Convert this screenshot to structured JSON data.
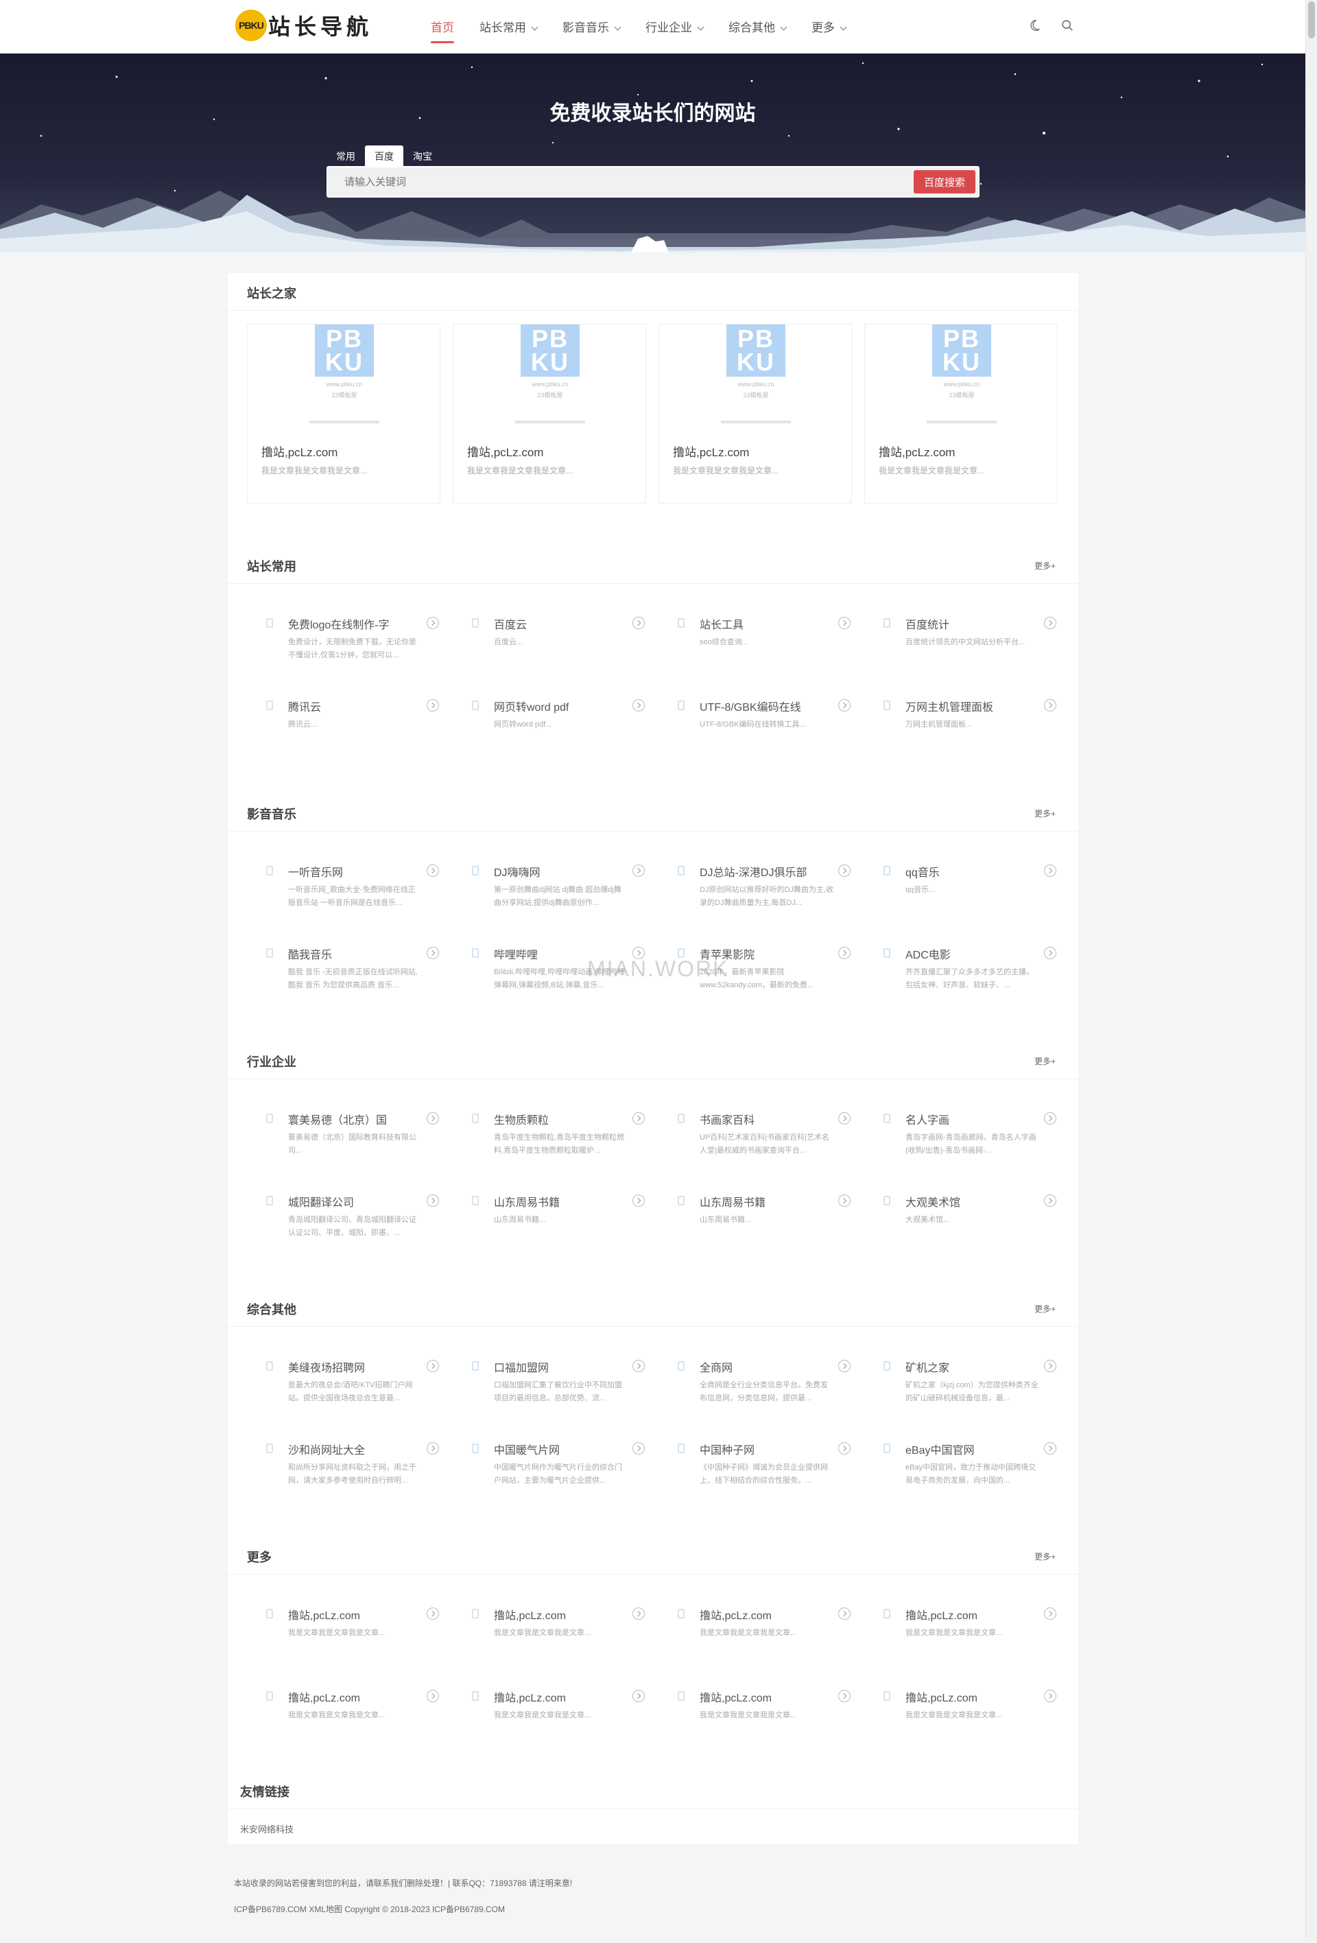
{
  "header": {
    "logo_badge": "PBKU",
    "logo_text": "站长导航",
    "nav": [
      {
        "label": "首页",
        "active": true,
        "has_menu": false
      },
      {
        "label": "站长常用",
        "active": false,
        "has_menu": true
      },
      {
        "label": "影音音乐",
        "active": false,
        "has_menu": true
      },
      {
        "label": "行业企业",
        "active": false,
        "has_menu": true
      },
      {
        "label": "综合其他",
        "active": false,
        "has_menu": true
      },
      {
        "label": "更多",
        "active": false,
        "has_menu": true
      }
    ],
    "icons": [
      "moon-icon",
      "search-icon"
    ]
  },
  "hero": {
    "title": "免费收录站长们的网站",
    "tabs": [
      "常用",
      "百度",
      "淘宝"
    ],
    "active_tab": 1,
    "search_placeholder": "请输入关键词",
    "search_button": "百度搜索"
  },
  "sections": [
    {
      "title": "站长之家",
      "more": "",
      "cards": [
        {
          "logo": "PBKU",
          "sub1": "www.pbku.cn",
          "sub2": "23模板屋",
          "title": "撸站,pcLz.com",
          "desc": "我是文章我是文章我是文章..."
        },
        {
          "logo": "PBKU",
          "sub1": "www.pbku.cn",
          "sub2": "23模板屋",
          "title": "撸站,pcLz.com",
          "desc": "我是文章我是文章我是文章..."
        },
        {
          "logo": "PBKU",
          "sub1": "www.pbku.cn",
          "sub2": "23模板屋",
          "title": "撸站,pcLz.com",
          "desc": "我是文章我是文章我是文章..."
        },
        {
          "logo": "PBKU",
          "sub1": "www.pbku.cn",
          "sub2": "23模板屋",
          "title": "撸站,pcLz.com",
          "desc": "我是文章我是文章我是文章..."
        }
      ]
    },
    {
      "title": "站长常用",
      "more": "更多+",
      "items": [
        {
          "title": "免费logo在线制作-字",
          "desc": "免费设计，无限制免费下载，无论你是不懂设计,仅需1分钟，您就可以..."
        },
        {
          "title": "百度云",
          "desc": "百度云..."
        },
        {
          "title": "站长工具",
          "desc": "seo综合查询..."
        },
        {
          "title": "百度统计",
          "desc": "百度统计领先的中文网站分析平台..."
        },
        {
          "title": "腾讯云",
          "desc": "腾讯云..."
        },
        {
          "title": "网页转word pdf",
          "desc": "网页转word pdf..."
        },
        {
          "title": "UTF-8/GBK编码在线",
          "desc": "UTF-8/GBK编码在线转换工具..."
        },
        {
          "title": "万网主机管理面板",
          "desc": "万网主机管理面板..."
        }
      ]
    },
    {
      "title": "影音音乐",
      "more": "更多+",
      "items": [
        {
          "title": "一听音乐网",
          "desc": "一听音乐网_歌曲大全-免费网络在线正版音乐站 一听音乐网是在线音乐..."
        },
        {
          "title": "DJ嗨嗨网",
          "desc": "第一原创舞曲dj网站 dj舞曲 超劲爆dj舞曲分享网站,提供dj舞曲原创作..."
        },
        {
          "title": "DJ总站-深港DJ俱乐部",
          "desc": "DJ原创网站以推荐好听的DJ舞曲为主,收录的DJ舞曲质量为主,每首DJ..."
        },
        {
          "title": "qq音乐",
          "desc": "qq音乐..."
        },
        {
          "title": "酷我音乐",
          "desc": "酷我 音乐 -无损音质正版在线试听网站,酷我 音乐 为您提供高品质 音乐..."
        },
        {
          "title": "哔哩哔哩",
          "desc": "Bilibili,哔哩哔哩,哔哩哔哩动画,哔哩哔哩弹幕网,弹幕视频,B站,弹幕,音乐..."
        },
        {
          "title": "青苹果影院",
          "desc": "2020年，最新青苹果影院 www.52kandy.com，最新的免费..."
        },
        {
          "title": "ADC电影",
          "desc": "齐齐直播汇聚了众多多才多艺的主播，包括女神、好声音、软妹子、..."
        }
      ]
    },
    {
      "title": "行业企业",
      "more": "更多+",
      "items": [
        {
          "title": "寰美易德（北京）国",
          "desc": "寰美易德（北京）国际教育科技有限公司..."
        },
        {
          "title": "生物质颗粒",
          "desc": "青岛平度生物颗粒,青岛平度生物颗粒燃料,青岛平度生物质颗粒取暖炉..."
        },
        {
          "title": "书画家百科",
          "desc": "UP百科|艺术家百科|书画家百科|艺术名人堂|最权威的书画家查询平台..."
        },
        {
          "title": "名人字画",
          "desc": "青岛字画网-青岛画廊网、青岛名人字画(收购/出售)-青岛书画网-..."
        },
        {
          "title": "城阳翻译公司",
          "desc": "青岛城阳翻译公司、青岛城阳翻译公证认证公司、平度、城阳、即墨、..."
        },
        {
          "title": "山东周易书籍",
          "desc": "山东周易书籍..."
        },
        {
          "title": "山东周易书籍",
          "desc": "山东周易书籍..."
        },
        {
          "title": "大观美术馆",
          "desc": "大观美术馆..."
        }
      ]
    },
    {
      "title": "综合其他",
      "more": "更多+",
      "items": [
        {
          "title": "美缝夜场招聘网",
          "desc": "是最大的夜总会/酒吧/KTV招聘门户网站。提供全国夜场夜总会生意最..."
        },
        {
          "title": "口福加盟网",
          "desc": "口福加盟网汇集了餐饮行业中不同加盟项目的最用信息。总部优势、流..."
        },
        {
          "title": "全商网",
          "desc": "全商网是全行业分类信息平台。免费发布信息网，分类信息网，提供最..."
        },
        {
          "title": "矿机之家",
          "desc": "矿机之家（kjzj.com）为您提供种类齐全的矿山破碎机械设备信息，最..."
        },
        {
          "title": "沙和尚网址大全",
          "desc": "和尚所分享网址资料取之于网，用之于网，请大家多参考使用时自行辨明..."
        },
        {
          "title": "中国暖气片网",
          "desc": "中国暖气片网作为暖气片行业的综合门户网站，主要为暖气片企业提供..."
        },
        {
          "title": "中国种子网",
          "desc": "《中国种子网》竭诚为会员企业提供网上、线下相结合的综合性服务。..."
        },
        {
          "title": "eBay中国官网",
          "desc": "eBay中国官网，致力于推动中国跨境交易电子商务的发展，向中国的..."
        }
      ]
    },
    {
      "title": "更多",
      "more": "更多+",
      "items": [
        {
          "title": "撸站,pcLz.com",
          "desc": "我是文章我是文章我是文章..."
        },
        {
          "title": "撸站,pcLz.com",
          "desc": "我是文章我是文章我是文章..."
        },
        {
          "title": "撸站,pcLz.com",
          "desc": "我是文章我是文章我是文章..."
        },
        {
          "title": "撸站,pcLz.com",
          "desc": "我是文章我是文章我是文章..."
        },
        {
          "title": "撸站,pcLz.com",
          "desc": "我是文章我是文章我是文章..."
        },
        {
          "title": "撸站,pcLz.com",
          "desc": "我是文章我是文章我是文章..."
        },
        {
          "title": "撸站,pcLz.com",
          "desc": "我是文章我是文章我是文章..."
        },
        {
          "title": "撸站,pcLz.com",
          "desc": "我是文章我是文章我是文章..."
        }
      ]
    }
  ],
  "links": {
    "title": "友情链接",
    "items": [
      "米安网络科技"
    ]
  },
  "watermark": "MIAN.WORK",
  "footer": {
    "line1": "本站收录的网站若侵害到您的利益，请联系我们删除处理！| 联系QQ：71893788 请注明来意!",
    "line2": "ICP备PB6789.COM XML地图 Copyright © 2018-2023 ICP备PB6789.COM"
  },
  "colors": {
    "accent": "#e45050",
    "search_button": "#d9484b",
    "hero_bg": "#1a1a2e",
    "logo_badge": "#f5b800",
    "logo_tile": "#b3d4f5"
  }
}
